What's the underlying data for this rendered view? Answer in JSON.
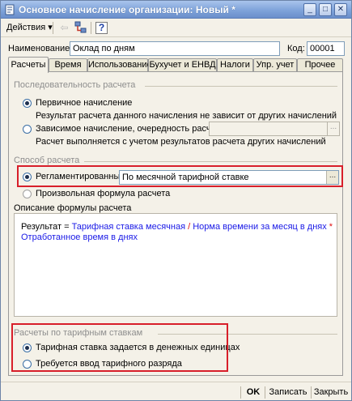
{
  "window": {
    "title": "Основное начисление организации: Новый *",
    "controls": {
      "minimize": "_",
      "maximize": "□",
      "close": "✕"
    }
  },
  "toolbar": {
    "actions_label": "Действия",
    "help_label": "?"
  },
  "form": {
    "name_label": "Наименование:",
    "name_value": "Оклад по дням",
    "code_label": "Код:",
    "code_value": "00001"
  },
  "tabs": [
    {
      "label": "Расчеты",
      "active": true
    },
    {
      "label": "Время"
    },
    {
      "label": "Использование"
    },
    {
      "label": "Бухучет и ЕНВД"
    },
    {
      "label": "Налоги"
    },
    {
      "label": "Упр. учет"
    },
    {
      "label": "Прочее"
    }
  ],
  "sequence": {
    "title": "Последовательность расчета",
    "primary_label": "Первичное начисление",
    "primary_hint": "Результат расчета данного начисления не зависит от других начислений",
    "dependent_label": "Зависимое начисление, очередность расчета:",
    "dependent_value": "",
    "dependent_hint": "Расчет выполняется с учетом результатов расчета других начислений",
    "selected": "primary"
  },
  "method": {
    "title": "Способ расчета",
    "regulated_label": "Регламентированный:",
    "regulated_value": "По месячной тарифной ставке",
    "formula_label": "Произвольная формула расчета",
    "selected": "regulated"
  },
  "description": {
    "title": "Описание формулы расчета",
    "prefix": "Результат = ",
    "term1": "Тарифная ставка месячная",
    "op1": " / ",
    "term2": "Норма времени за месяц в днях",
    "op2": " *",
    "term3": "Отработанное время в днях"
  },
  "tariff": {
    "title": "Расчеты по тарифным ставкам",
    "money_label": "Тарифная ставка задается в денежных единицах",
    "grade_label": "Требуется ввод тарифного разряда",
    "selected": "money"
  },
  "bottom": {
    "ok_label": "OK",
    "save_label": "Записать",
    "close_label": "Закрыть"
  },
  "colors": {
    "formula_term": "#1a1ae6",
    "formula_operator": "#e01010",
    "highlight_frame": "#d81f2a"
  }
}
